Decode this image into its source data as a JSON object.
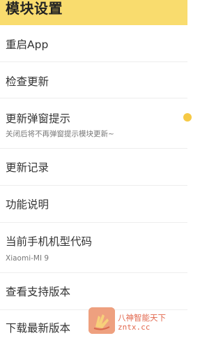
{
  "header": {
    "title": "模块设置",
    "background_color": "#f9dc6e"
  },
  "settings": [
    {
      "label": "重启App"
    },
    {
      "label": "检查更新"
    },
    {
      "label": "更新弹窗提示",
      "subtitle": "关闭后将不再弹窗提示模块更新~",
      "toggle": true
    },
    {
      "label": "更新记录"
    },
    {
      "label": "功能说明"
    },
    {
      "label": "当前手机机型代码",
      "subtitle": "Xiaomi-MI 9"
    },
    {
      "label": "查看支持版本"
    },
    {
      "label": "下载最新版本"
    }
  ],
  "watermark": {
    "name": "八神智能天下",
    "url": "zntx.cc"
  },
  "colors": {
    "accent": "#f6c945",
    "divider": "#eeeeee"
  }
}
